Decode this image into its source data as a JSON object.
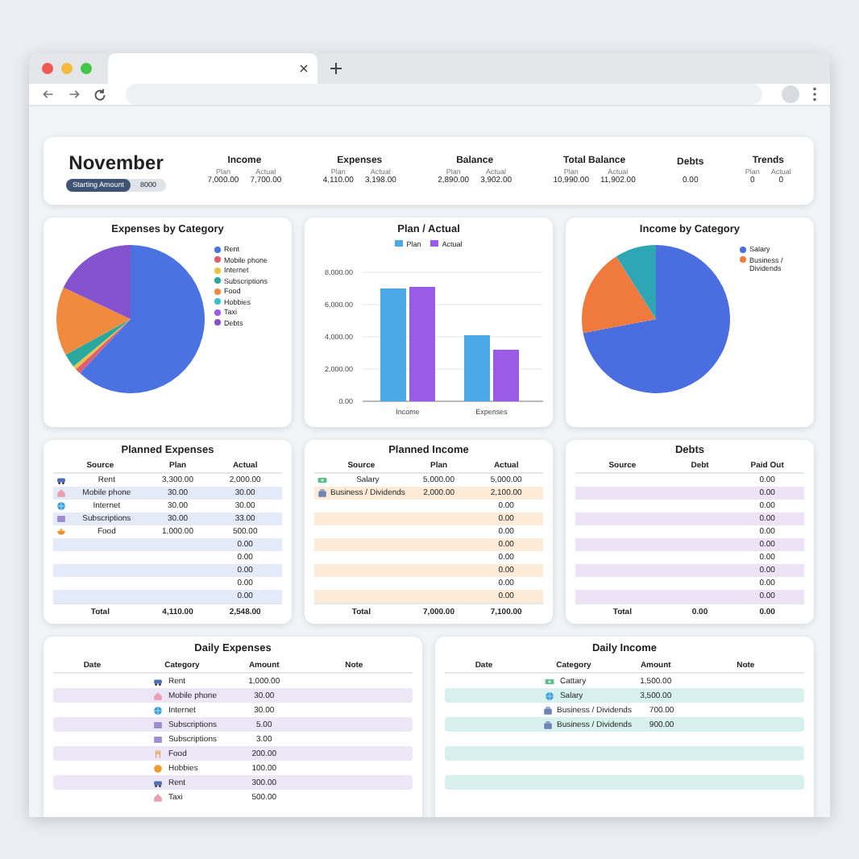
{
  "summary": {
    "month": "November",
    "starting_amount": {
      "label": "Starting Amount",
      "value": "8000"
    },
    "metrics": [
      {
        "title": "Income",
        "kind": "pair",
        "plan_label": "Plan",
        "plan": "7,000.00",
        "actual_label": "Actual",
        "actual": "7,700.00"
      },
      {
        "title": "Expenses",
        "kind": "pair",
        "plan_label": "Plan",
        "plan": "4,110.00",
        "actual_label": "Actual",
        "actual": "3,198.00"
      },
      {
        "title": "Balance",
        "kind": "pair",
        "plan_label": "Plan",
        "plan": "2,890.00",
        "actual_label": "Actual",
        "actual": "3,902.00"
      },
      {
        "title": "Total Balance",
        "kind": "pair",
        "plan_label": "Plan",
        "plan": "10,990.00",
        "actual_label": "Actual",
        "actual": "11,902.00"
      },
      {
        "title": "Debts",
        "kind": "single",
        "value": "0.00"
      },
      {
        "title": "Trends",
        "kind": "pair",
        "plan_label": "Plan",
        "plan": "0",
        "actual_label": "Actual",
        "actual": "0"
      }
    ]
  },
  "charts": [
    {
      "kind": "pie",
      "title": "Expenses by Category",
      "legend": [
        {
          "label": "Rent",
          "color": "#4a72e0"
        },
        {
          "label": "Mobile phone",
          "color": "#e25c6e"
        },
        {
          "label": "Internet",
          "color": "#e8c24a"
        },
        {
          "label": "Subscriptions",
          "color": "#2aa89e"
        },
        {
          "label": "Food",
          "color": "#f08a3e"
        },
        {
          "label": "Hobbies",
          "color": "#3cbfc8"
        },
        {
          "label": "Taxi",
          "color": "#9a5ce6"
        },
        {
          "label": "Debts",
          "color": "#8452cc"
        }
      ]
    },
    {
      "kind": "bar",
      "title": "Plan / Actual",
      "chart_data": {
        "type": "bar",
        "categories": [
          "Income",
          "Expenses"
        ],
        "series": [
          {
            "name": "Plan",
            "color": "#4aa8e6",
            "values": [
              7000,
              4100
            ]
          },
          {
            "name": "Actual",
            "color": "#9a5ce6",
            "values": [
              7100,
              3200
            ]
          }
        ],
        "grid": true,
        "ylim": [
          0,
          8000
        ],
        "yticks": [
          {
            "value": 0,
            "label": "0.00"
          },
          {
            "value": 2000,
            "label": "2,000.00"
          },
          {
            "value": 4000,
            "label": "4,000.00"
          },
          {
            "value": 6000,
            "label": "6,000.00"
          },
          {
            "value": 8000,
            "label": "8,000.00"
          }
        ]
      }
    },
    {
      "kind": "pie",
      "title": "Income by Category",
      "legend": [
        {
          "label": "Salary",
          "color": "#4a6ee0"
        },
        {
          "label": "Business / Dividends",
          "color": "#f07a3e"
        }
      ]
    }
  ],
  "tables": [
    {
      "title": "Planned Expenses",
      "columns": [
        "Source",
        "Plan",
        "Actual"
      ],
      "rows": [
        {
          "kind": "car",
          "source": "Rent",
          "plan": "3,300.00",
          "actual": "2,000.00"
        },
        {
          "kind": "house",
          "source": "Mobile phone",
          "plan": "30.00",
          "actual": "30.00"
        },
        {
          "kind": "globe",
          "source": "Internet",
          "plan": "30.00",
          "actual": "30.00"
        },
        {
          "kind": "film",
          "source": "Subscriptions",
          "plan": "30.00",
          "actual": "33.00"
        },
        {
          "kind": "bowl",
          "source": "Food",
          "plan": "1,000.00",
          "actual": "500.00"
        },
        {
          "actual": "0.00"
        },
        {
          "actual": "0.00"
        },
        {
          "actual": "0.00"
        },
        {
          "actual": "0.00"
        },
        {
          "actual": "0.00"
        }
      ],
      "total": [
        "Total",
        "4,110.00",
        "2,548.00"
      ]
    },
    {
      "title": "Planned Income",
      "columns": [
        "Source",
        "Plan",
        "Actual"
      ],
      "rows": [
        {
          "kind": "cash",
          "source": "Salary",
          "plan": "5,000.00",
          "actual": "5,000.00"
        },
        {
          "kind": "case",
          "source": "Business / Dividends",
          "plan": "2,000.00",
          "actual": "2,100.00"
        },
        {
          "actual": "0.00"
        },
        {
          "actual": "0.00"
        },
        {
          "actual": "0.00"
        },
        {
          "actual": "0.00"
        },
        {
          "actual": "0.00"
        },
        {
          "actual": "0.00"
        },
        {
          "actual": "0.00"
        },
        {
          "actual": "0.00"
        }
      ],
      "total": [
        "Total",
        "7,000.00",
        "7,100.00"
      ]
    },
    {
      "title": "Debts",
      "columns": [
        "Source",
        "Debt",
        "Paid Out"
      ],
      "rows": [
        {
          "paid_out": "0.00"
        },
        {
          "paid_out": "0.00"
        },
        {
          "paid_out": "0.00"
        },
        {
          "paid_out": "0.00"
        },
        {
          "paid_out": "0.00"
        },
        {
          "paid_out": "0.00"
        },
        {
          "paid_out": "0.00"
        },
        {
          "paid_out": "0.00"
        },
        {
          "paid_out": "0.00"
        },
        {
          "paid_out": "0.00"
        }
      ],
      "total": [
        "Total",
        "0.00",
        "0.00"
      ]
    }
  ],
  "daily": [
    {
      "title": "Daily Expenses",
      "columns": [
        "Date",
        "Category",
        "Amount",
        "Note"
      ],
      "rows": [
        {
          "kind": "car",
          "category": "Rent",
          "amount": "1,000.00"
        },
        {
          "kind": "house",
          "category": "Mobile phone",
          "amount": "30.00"
        },
        {
          "kind": "globe",
          "category": "Internet",
          "amount": "30.00"
        },
        {
          "kind": "film",
          "category": "Subscriptions",
          "amount": "5.00"
        },
        {
          "kind": "film",
          "category": "Subscriptions",
          "amount": "3.00"
        },
        {
          "kind": "fork",
          "category": "Food",
          "amount": "200.00"
        },
        {
          "kind": "ball",
          "category": "Hobbies",
          "amount": "100.00"
        },
        {
          "kind": "car",
          "category": "Rent",
          "amount": "300.00"
        },
        {
          "kind": "house",
          "category": "Taxi",
          "amount": "500.00"
        }
      ]
    },
    {
      "title": "Daily Income",
      "columns": [
        "Date",
        "Category",
        "Amount",
        "Note"
      ],
      "rows": [
        {
          "kind": "cash",
          "category": "Cattary",
          "amount": "1,500.00"
        },
        {
          "kind": "globe",
          "category": "Salary",
          "amount": "3,500.00"
        },
        {
          "kind": "case",
          "category": "Business / Dividends",
          "amount": "700.00"
        },
        {
          "kind": "case",
          "category": "Business / Dividends",
          "amount": "900.00"
        }
      ]
    }
  ]
}
